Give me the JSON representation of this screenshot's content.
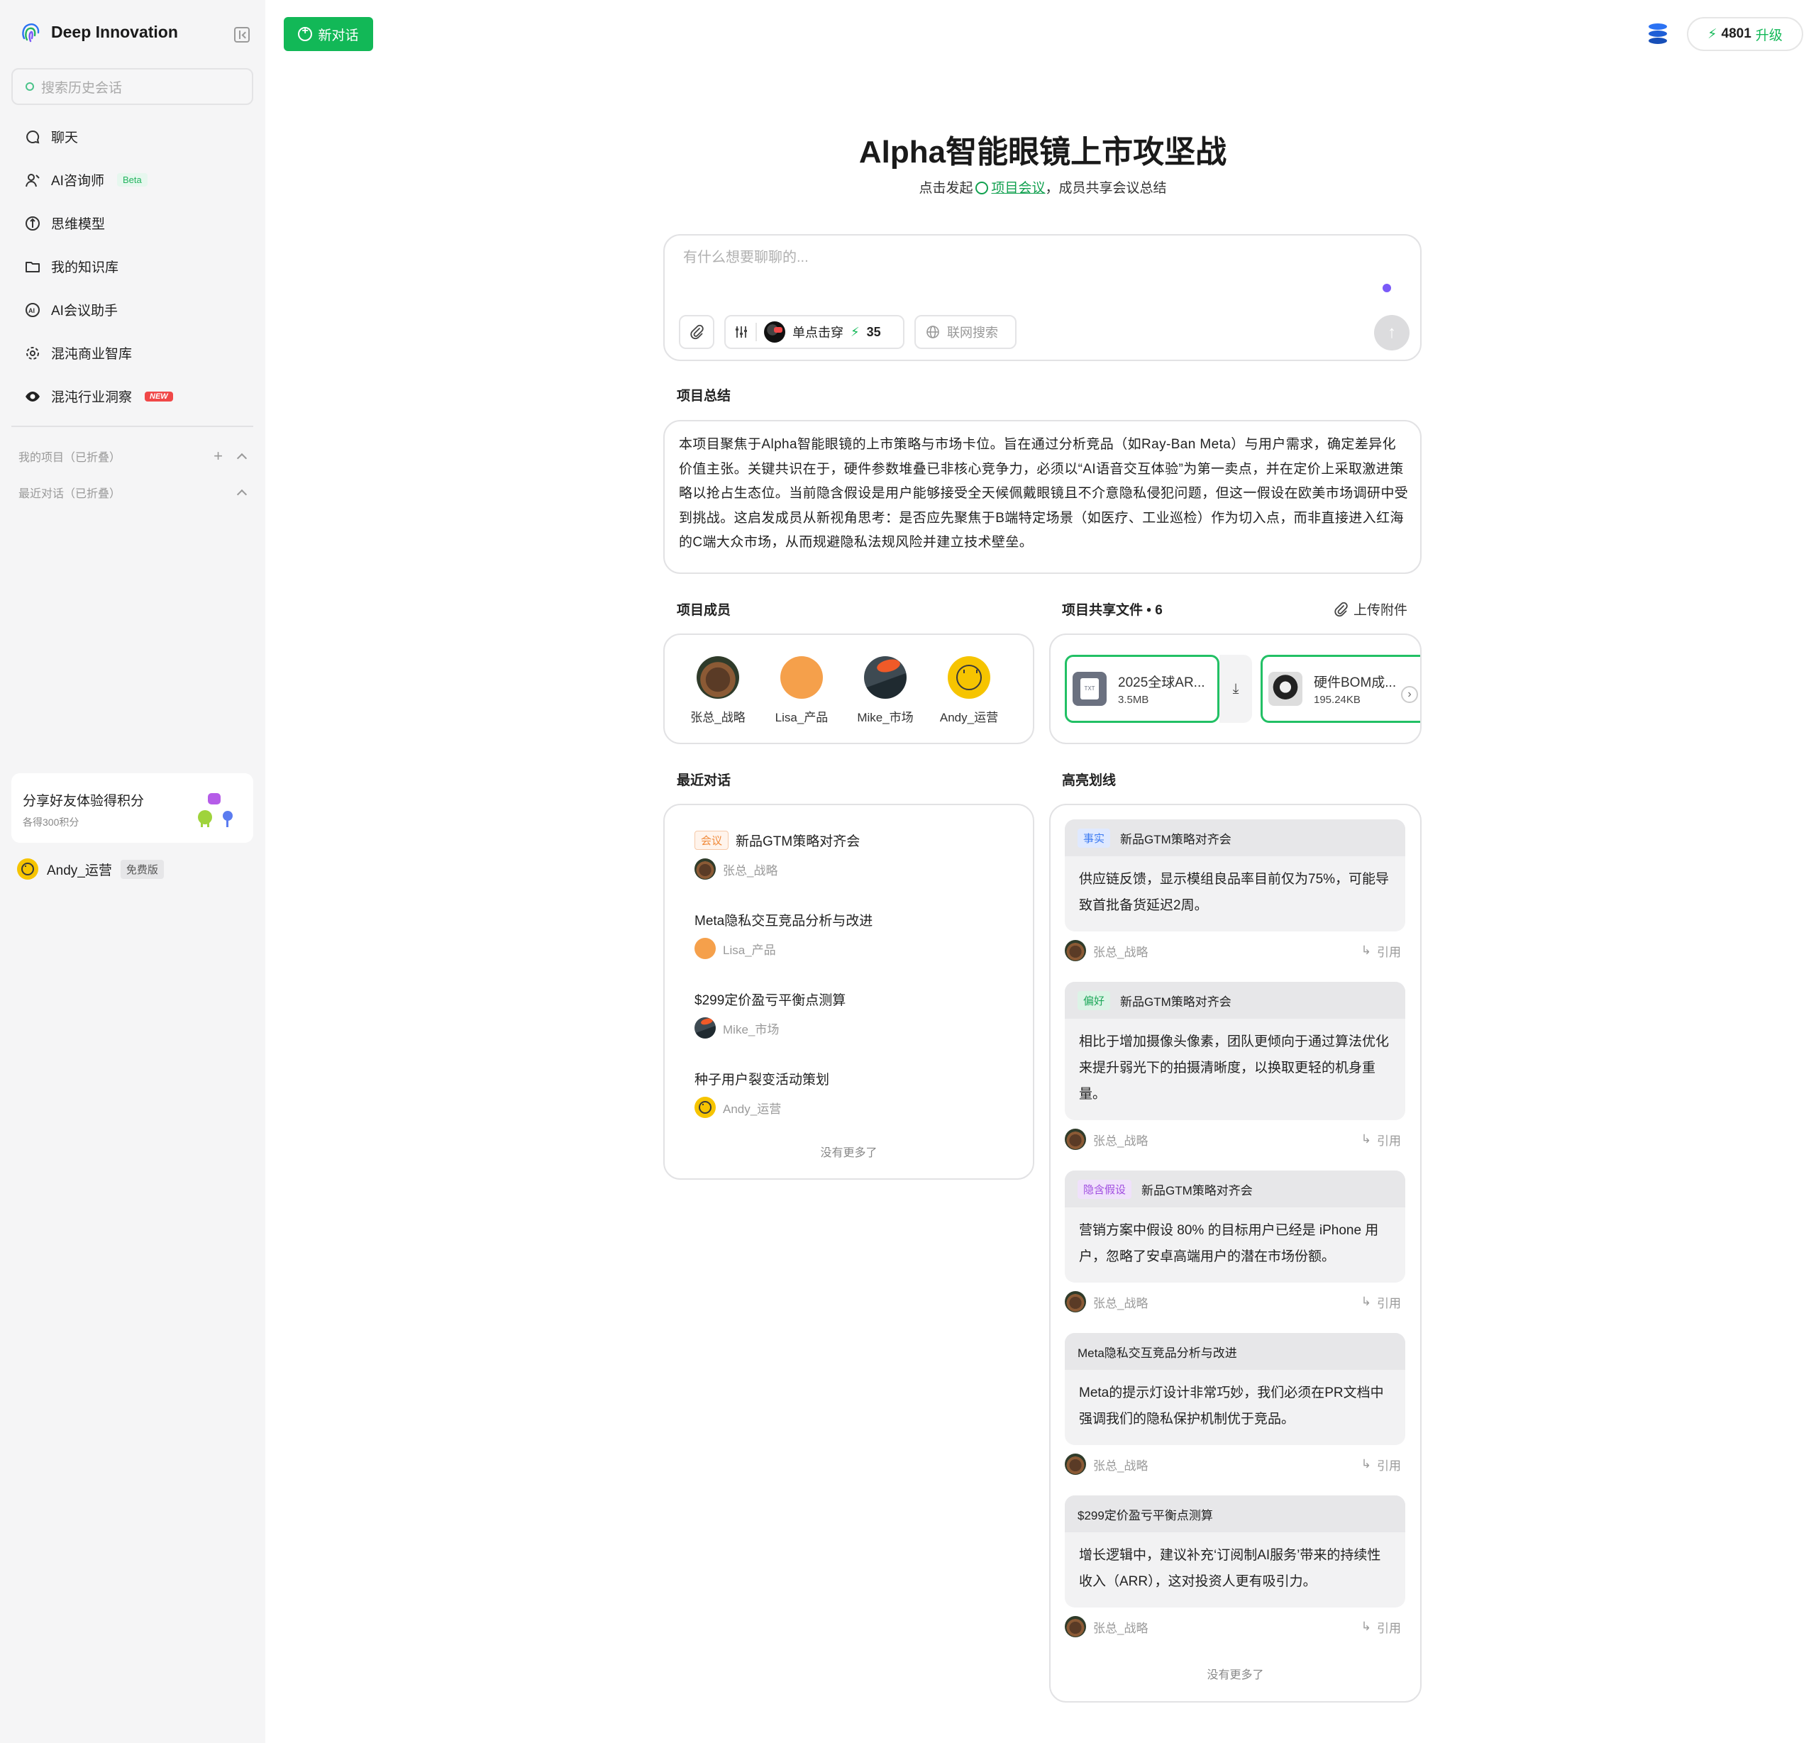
{
  "brand": {
    "name": "Deep Innovation"
  },
  "sidebar": {
    "search_placeholder": "搜索历史会话",
    "items": [
      {
        "label": "聊天",
        "icon": "chat-icon"
      },
      {
        "label": "AI咨询师",
        "icon": "consultant-icon",
        "badge": "Beta"
      },
      {
        "label": "思维模型",
        "icon": "compass-icon"
      },
      {
        "label": "我的知识库",
        "icon": "folder-icon"
      },
      {
        "label": "AI会议助手",
        "icon": "ai-meeting-icon"
      },
      {
        "label": "混沌商业智库",
        "icon": "gear-flower-icon"
      },
      {
        "label": "混沌行业洞察",
        "icon": "eye-icon",
        "badge": "NEW"
      }
    ],
    "groups": [
      {
        "label": "我的项目（已折叠）"
      },
      {
        "label": "最近对话（已折叠）"
      }
    ],
    "share": {
      "title": "分享好友体验得积分",
      "subtitle": "各得300积分"
    },
    "user": {
      "name": "Andy_运营",
      "plan": "免费版"
    }
  },
  "header": {
    "new_chat": "新对话",
    "credits": "4801",
    "upgrade_label": "升级"
  },
  "project": {
    "title": "Alpha智能眼镜上市攻坚战",
    "subtitle_prefix": "点击发起",
    "subtitle_link": "项目会议",
    "subtitle_suffix": "，成员共享会议总结"
  },
  "composer": {
    "placeholder": "有什么想要聊聊的...",
    "mode_label": "单点击穿",
    "mode_cost": "35",
    "web_search": "联网搜索"
  },
  "summary": {
    "label": "项目总结",
    "text": "本项目聚焦于Alpha智能眼镜的上市策略与市场卡位。旨在通过分析竞品（如Ray-Ban Meta）与用户需求，确定差异化价值主张。关键共识在于，硬件参数堆叠已非核心竞争力，必须以“AI语音交互体验”为第一卖点，并在定价上采取激进策略以抢占生态位。当前隐含假设是用户能够接受全天候佩戴眼镜且不介意隐私侵犯问题，但这一假设在欧美市场调研中受到挑战。这启发成员从新视角思考：是否应先聚焦于B端特定场景（如医疗、工业巡检）作为切入点，而非直接进入红海的C端大众市场，从而规避隐私法规风险并建立技术壁垒。"
  },
  "members": {
    "label": "项目成员",
    "list": [
      {
        "name": "张总_战略",
        "avatar": "bear"
      },
      {
        "name": "Lisa_产品",
        "avatar": "orange"
      },
      {
        "name": "Mike_市场",
        "avatar": "mike"
      },
      {
        "name": "Andy_运营",
        "avatar": "smiley"
      }
    ]
  },
  "files": {
    "label": "项目共享文件",
    "count": "6",
    "upload": "上传附件",
    "list": [
      {
        "name": "2025全球AR...",
        "size": "3.5MB",
        "type": "TXT"
      },
      {
        "name": "硬件BOM成...",
        "size": "195.24KB",
        "type": "image"
      }
    ]
  },
  "recent": {
    "label": "最近对话",
    "list": [
      {
        "title": "新品GTM策略对齐会",
        "tag": "会议",
        "author": "张总_战略",
        "avatar": "bear"
      },
      {
        "title": "Meta隐私交互竞品分析与改进",
        "author": "Lisa_产品",
        "avatar": "orange"
      },
      {
        "title": "$299定价盈亏平衡点测算",
        "author": "Mike_市场",
        "avatar": "mike"
      },
      {
        "title": "种子用户裂变活动策划",
        "author": "Andy_运营",
        "avatar": "smiley"
      }
    ],
    "no_more": "没有更多了"
  },
  "highlights": {
    "label": "高亮划线",
    "quote_label": "引用",
    "list": [
      {
        "tag": "事实",
        "source": "新品GTM策略对齐会",
        "text": "供应链反馈，显示模组良品率目前仅为75%，可能导致首批备货延迟2周。",
        "author": "张总_战略"
      },
      {
        "tag": "偏好",
        "source": "新品GTM策略对齐会",
        "text": "相比于增加摄像头像素，团队更倾向于通过算法优化来提升弱光下的拍摄清晰度，以换取更轻的机身重量。",
        "author": "张总_战略"
      },
      {
        "tag": "隐含假设",
        "source": "新品GTM策略对齐会",
        "text": "营销方案中假设 80% 的目标用户已经是 iPhone 用户，忽略了安卓高端用户的潜在市场份额。",
        "author": "张总_战略"
      },
      {
        "tag": "",
        "source": "Meta隐私交互竞品分析与改进",
        "text": "Meta的提示灯设计非常巧妙，我们必须在PR文档中强调我们的隐私保护机制优于竞品。",
        "author": "张总_战略"
      },
      {
        "tag": "",
        "source": "$299定价盈亏平衡点测算",
        "text": "增长逻辑中，建议补充‘订阅制AI服务’带来的持续性收入（ARR），这对投资人更有吸引力。",
        "author": "张总_战略"
      }
    ],
    "no_more": "没有更多了"
  },
  "colors": {
    "accent": "#12b857",
    "sidebar_bg": "#f5f5f6",
    "composer_dot": "#7a5af8"
  }
}
